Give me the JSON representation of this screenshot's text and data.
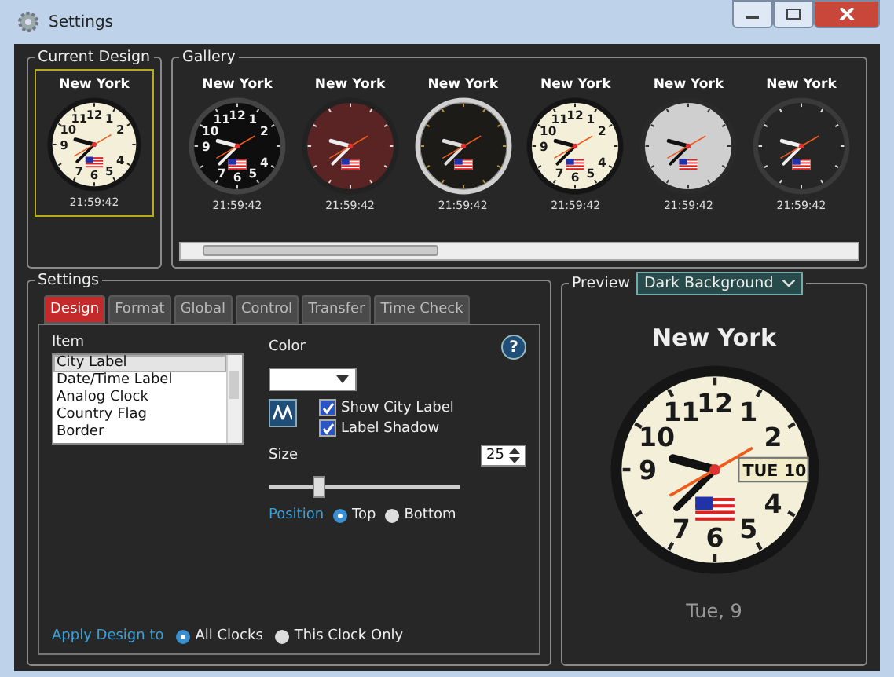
{
  "window": {
    "title": "Settings"
  },
  "current_design": {
    "title": "Current Design",
    "clock": {
      "city": "New York",
      "kind": "cream",
      "numerals": [
        "12",
        "11",
        "1",
        "10",
        "2",
        "9",
        "4",
        "7",
        "6",
        "5"
      ],
      "time": "21:59:42"
    }
  },
  "gallery": {
    "title": "Gallery",
    "clocks": [
      {
        "city": "New York",
        "kind": "black",
        "numerals": [
          "12",
          "11",
          "1",
          "10",
          "2",
          "9",
          "4",
          "7",
          "6",
          "5"
        ],
        "time": "21:59:42"
      },
      {
        "city": "New York",
        "kind": "maroon",
        "time": "21:59:42"
      },
      {
        "city": "New York",
        "kind": "ring",
        "time": "21:59:42"
      },
      {
        "city": "New York",
        "kind": "cream",
        "numerals": [
          "12",
          "11",
          "1",
          "10",
          "2",
          "9",
          "4",
          "7",
          "6",
          "5"
        ],
        "time": "21:59:42"
      },
      {
        "city": "New York",
        "kind": "silver",
        "time": "21:59:42"
      },
      {
        "city": "New York",
        "kind": "minimal",
        "time": "21:59:42"
      }
    ]
  },
  "settings": {
    "title": "Settings",
    "tabs": [
      {
        "label": "Design",
        "selected": true
      },
      {
        "label": "Format",
        "selected": false
      },
      {
        "label": "Global",
        "selected": false
      },
      {
        "label": "Control",
        "selected": false
      },
      {
        "label": "Transfer",
        "selected": false
      },
      {
        "label": "Time Check",
        "selected": false
      }
    ],
    "item_label": "Item",
    "items": [
      {
        "label": "City Label",
        "selected": true
      },
      {
        "label": "Date/Time Label",
        "selected": false
      },
      {
        "label": "Analog Clock",
        "selected": false
      },
      {
        "label": "Country Flag",
        "selected": false
      },
      {
        "label": "Border",
        "selected": false
      }
    ],
    "help": "?",
    "color_label": "Color",
    "checkboxes": [
      {
        "label": "Show City Label",
        "checked": true
      },
      {
        "label": "Label Shadow",
        "checked": true
      }
    ],
    "size_label": "Size",
    "size_value": "25",
    "size_slider": {
      "level": 0.25
    },
    "position_label": "Position",
    "position_options": [
      {
        "label": "Top",
        "selected": true
      },
      {
        "label": "Bottom",
        "selected": false
      }
    ],
    "apply_label": "Apply Design to",
    "apply_options": [
      {
        "label": "All Clocks",
        "selected": true
      },
      {
        "label": "This Clock Only",
        "selected": false
      }
    ]
  },
  "preview": {
    "title": "Preview",
    "background": "Dark Background",
    "clock": {
      "city": "New York",
      "kind": "cream",
      "numerals": [
        "12",
        "11",
        "1",
        "10",
        "2",
        "9",
        "4",
        "7",
        "6",
        "5"
      ],
      "date_window": [
        "TUE",
        "10"
      ]
    },
    "date_text": "Tue, 9"
  }
}
